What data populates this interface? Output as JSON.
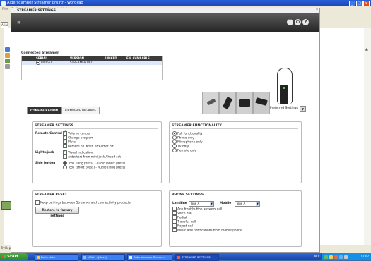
{
  "wordpad": {
    "title": "Aldersdamper Streamer pro.rtf - WordPad",
    "menu": [
      "Filer",
      "Rediger",
      "Vis",
      "Sett inn",
      "Format",
      "Hjelp"
    ],
    "font_box": "Arial",
    "status_text": "Trykk på F1 for å få hjelp"
  },
  "dialog": {
    "title": "STREAMER SETTINGS",
    "close_label": "X",
    "icons": [
      "wifi-icon",
      "headset-icon",
      "power-icon",
      "help-icon"
    ],
    "connected_streamer": {
      "label": "Connected Streamer",
      "columns": [
        "SERIAL",
        "VERSION",
        "LINKED",
        "FW AVAILABLE"
      ],
      "rows": [
        {
          "serial": "800651",
          "version": "STREAMER PRO",
          "linked": "",
          "fw": ""
        }
      ]
    },
    "tabs": [
      {
        "label": "CONFIGURATION",
        "active": true
      },
      {
        "label": "FIRMWARE UPGRADE",
        "active": false
      }
    ],
    "preferred_settings_label": "Preferred Settings",
    "streamer_settings": {
      "title": "STREAMER SETTINGS",
      "remote_control_label": "Remote Control",
      "remote_control_options": [
        {
          "label": "Volume control",
          "checked": true
        },
        {
          "label": "Change program",
          "checked": true
        },
        {
          "label": "Mute",
          "checked": true
        },
        {
          "label": "Remote on when Streamer off",
          "checked": true
        }
      ],
      "lights_label": "Lights/jack",
      "lights_options": [
        {
          "label": "Visual indication",
          "checked": true
        },
        {
          "label": "Autostart from mini jack / head set",
          "checked": false
        }
      ],
      "side_button_label": "Side button",
      "side_button_options": [
        {
          "label": "Tcoil (long press) - Audio (short press)",
          "selected": true
        },
        {
          "label": "Tcoil (short press) - Audio (long press)",
          "selected": false
        }
      ]
    },
    "streamer_functionality": {
      "title": "STREAMER FUNCTIONALITY",
      "options": [
        {
          "label": "Full functionality",
          "selected": true
        },
        {
          "label": "Phone only",
          "selected": false
        },
        {
          "label": "Microphone only",
          "selected": false
        },
        {
          "label": "TV only",
          "selected": false
        },
        {
          "label": "Remote only",
          "selected": false
        }
      ]
    },
    "streamer_reset": {
      "title": "STREAMER RESET",
      "keep_pairings_label": "Keep pairings between Streamer and connectivity products",
      "keep_pairings_checked": true,
      "restore_button": "Restore to factory settings"
    },
    "phone_settings": {
      "title": "PHONE SETTINGS",
      "landline_label": "Landline",
      "landline_value": "Tone A",
      "mobile_label": "Mobile",
      "mobile_value": "Tone A",
      "options": [
        {
          "label": "Any front button answers call",
          "checked": false
        },
        {
          "label": "Voice dial",
          "checked": false
        },
        {
          "label": "Redial",
          "checked": false
        },
        {
          "label": "Transfer call",
          "checked": false
        },
        {
          "label": "Reject call",
          "checked": false
        },
        {
          "label": "Music and notifications from mobile phone",
          "checked": false
        }
      ]
    }
  },
  "taskbar": {
    "start_label": "Start",
    "items": [
      {
        "label": "Delte data",
        "active": false
      },
      {
        "label": "NOAH - [Sess]",
        "active": false
      },
      {
        "label": "Aldersdamper Stream...",
        "active": false
      },
      {
        "label": "STREAMER SETTINGS",
        "active": true
      }
    ],
    "lang": "NO",
    "clock": "17:07"
  },
  "colors": {
    "titlebar_blue": "#2a5fd6",
    "dialog_header_dark": "#2b2b2b",
    "taskbar_blue": "#245edb",
    "start_green": "#3c9a38",
    "check_green": "#236b23"
  }
}
